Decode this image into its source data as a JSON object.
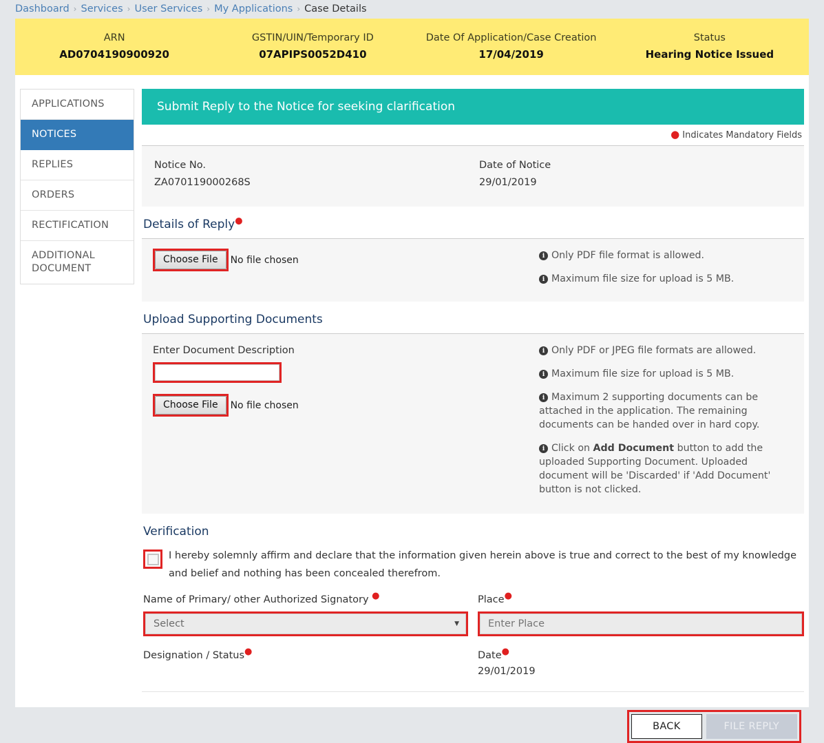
{
  "breadcrumb": {
    "items": [
      {
        "label": "Dashboard",
        "current": false
      },
      {
        "label": "Services",
        "current": false
      },
      {
        "label": "User Services",
        "current": false
      },
      {
        "label": "My Applications",
        "current": false
      },
      {
        "label": "Case Details",
        "current": true
      }
    ],
    "separator": "›"
  },
  "case_banner": {
    "background": "#ffeb75",
    "cells": [
      {
        "label": "ARN",
        "value": "AD0704190900920"
      },
      {
        "label": "GSTIN/UIN/Temporary ID",
        "value": "07APIPS0052D410"
      },
      {
        "label": "Date Of Application/Case Creation",
        "value": "17/04/2019"
      },
      {
        "label": "Status",
        "value": "Hearing Notice Issued"
      }
    ]
  },
  "sidebar": {
    "items": [
      {
        "label": "APPLICATIONS",
        "active": false
      },
      {
        "label": "NOTICES",
        "active": true
      },
      {
        "label": "REPLIES",
        "active": false
      },
      {
        "label": "ORDERS",
        "active": false
      },
      {
        "label": "RECTIFICATION",
        "active": false
      },
      {
        "label": "ADDITIONAL DOCUMENT",
        "active": false
      }
    ],
    "active_color": "#337ab7"
  },
  "main": {
    "header_title": "Submit Reply to the Notice for seeking clarification",
    "header_color": "#1abcae",
    "mandatory_note": "Indicates Mandatory Fields",
    "notice": {
      "notice_no_label": "Notice No.",
      "notice_no_value": "ZA070119000268S",
      "date_label": "Date of Notice",
      "date_value": "29/01/2019"
    },
    "details_of_reply": {
      "title": "Details of Reply",
      "choose_file_label": "Choose File",
      "no_file_text": "No file chosen",
      "info": [
        "Only PDF file format is allowed.",
        "Maximum file size for upload is 5 MB."
      ]
    },
    "upload_supporting": {
      "title": "Upload Supporting Documents",
      "description_label": "Enter Document Description",
      "description_value": "",
      "choose_file_label": "Choose File",
      "no_file_text": "No file chosen",
      "info1": "Only PDF or JPEG file formats are allowed.",
      "info2": "Maximum file size for upload is 5 MB.",
      "info3": "Maximum 2 supporting documents can be attached in the application. The remaining documents can be handed over in hard copy.",
      "info4_pre": "Click on ",
      "info4_bold": "Add Document",
      "info4_post": " button to add the uploaded Supporting Document. Uploaded document will be 'Discarded' if 'Add Document' button is not clicked."
    },
    "verification": {
      "title": "Verification",
      "checkbox_checked": false,
      "declaration": "I hereby solemnly affirm and declare that the information given herein above is true and correct to the best of my knowledge and belief and nothing has been concealed therefrom.",
      "signatory_label": "Name of Primary/ other Authorized Signatory",
      "signatory_selected": "Select",
      "place_label": "Place",
      "place_placeholder": "Enter Place",
      "place_value": "",
      "designation_label": "Designation / Status",
      "designation_value": "",
      "date_label": "Date",
      "date_value": "29/01/2019"
    },
    "buttons": {
      "back": "BACK",
      "file_reply": "FILE REPLY"
    }
  },
  "colors": {
    "accent_red": "#e02424",
    "teal": "#1abcae",
    "blue": "#337ab7",
    "yellow": "#ffeb75"
  }
}
